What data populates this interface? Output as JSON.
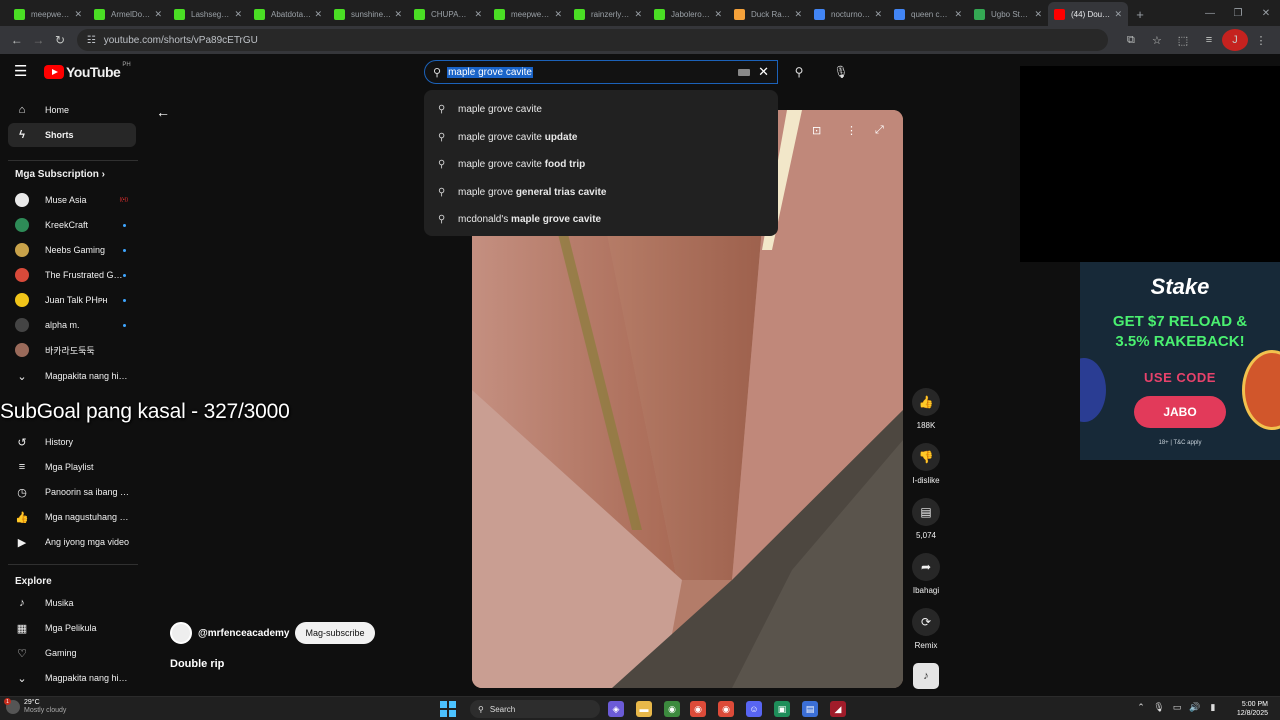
{
  "browser": {
    "tabs": [
      {
        "label": "meepwe…",
        "favicon_color": "#4ade24",
        "active": false
      },
      {
        "label": "ArmelDot…",
        "favicon_color": "#4ade24",
        "active": false
      },
      {
        "label": "Lashsegw…",
        "favicon_color": "#4ade24",
        "active": false
      },
      {
        "label": "Abatdota…",
        "favicon_color": "#4ade24",
        "active": false
      },
      {
        "label": "sunshinen…",
        "favicon_color": "#4ade24",
        "active": false
      },
      {
        "label": "CHUPAEN…",
        "favicon_color": "#4ade24",
        "active": false
      },
      {
        "label": "meepwe…",
        "favicon_color": "#4ade24",
        "active": false
      },
      {
        "label": "rainzerlyn…",
        "favicon_color": "#4ade24",
        "active": false
      },
      {
        "label": "JaboleroD…",
        "favicon_color": "#4ade24",
        "active": false
      },
      {
        "label": "Duck Race…",
        "favicon_color": "#f4a13a",
        "active": false
      },
      {
        "label": "nocturno…",
        "favicon_color": "#4285f4",
        "active": false
      },
      {
        "label": "queen coa…",
        "favicon_color": "#4285f4",
        "active": false
      },
      {
        "label": "Ugbo St…",
        "favicon_color": "#34a853",
        "active": false
      },
      {
        "label": "(44) Doub…",
        "favicon_color": "#ff0000",
        "active": true
      }
    ],
    "url": "youtube.com/shorts/vPa89cETrGU",
    "profile_initial": "J"
  },
  "masthead": {
    "logo_text": "YouTube",
    "country_code": "PH",
    "search_value": "maple grove cavite"
  },
  "suggestions": [
    {
      "base": "maple grove cavite",
      "bold": ""
    },
    {
      "base": "maple grove cavite ",
      "bold": "update"
    },
    {
      "base": "maple grove cavite ",
      "bold": "food trip"
    },
    {
      "base": "maple grove ",
      "bold": "general trias cavite"
    },
    {
      "base": "mcdonald's ",
      "bold": "maple grove cavite"
    }
  ],
  "sidebar": {
    "main": [
      {
        "label": "Home",
        "icon": "home-icon"
      },
      {
        "label": "Shorts",
        "icon": "shorts-icon",
        "active": true
      }
    ],
    "subscriptions_title": "Mga Subscription",
    "subscriptions": [
      {
        "label": "Muse Asia",
        "avatar_color": "#e9e9e9",
        "badge": "live"
      },
      {
        "label": "KreekCraft",
        "avatar_color": "#2e8b57",
        "badge": "dot"
      },
      {
        "label": "Neebs Gaming",
        "avatar_color": "#c8a24a",
        "badge": "dot"
      },
      {
        "label": "The Frustrated G…",
        "avatar_color": "#d84a3a",
        "badge": "dot"
      },
      {
        "label": "Juan Talk PHᴘʜ",
        "avatar_color": "#f0c419",
        "badge": "dot"
      },
      {
        "label": "alpha m.",
        "avatar_color": "#444444",
        "badge": "dot"
      },
      {
        "label": "바카라도둑둑",
        "avatar_color": "#9a6a5a",
        "badge": ""
      }
    ],
    "show_more": "Magpakita nang hi…",
    "you_items": [
      {
        "label": "History",
        "icon": "history-icon"
      },
      {
        "label": "Mga Playlist",
        "icon": "playlist-icon"
      },
      {
        "label": "Panoorin sa ibang …",
        "icon": "watch-later-icon"
      },
      {
        "label": "Mga nagustuhang …",
        "icon": "like-icon"
      },
      {
        "label": "Ang iyong mga video",
        "icon": "your-videos-icon"
      }
    ],
    "explore_title": "Explore",
    "explore": [
      {
        "label": "Musika",
        "icon": "music-icon"
      },
      {
        "label": "Mga Pelikula",
        "icon": "movies-icon"
      },
      {
        "label": "Gaming",
        "icon": "gaming-icon"
      },
      {
        "label": "Magpakita nang hi…",
        "icon": "chevron-down-icon"
      }
    ]
  },
  "overlay": {
    "text": "SubGoal pang kasal - 327/3000"
  },
  "short": {
    "channel": "@mrfenceacademy",
    "subscribe_label": "Mag-subscribe",
    "title": "Double rip"
  },
  "actions": [
    {
      "label": "188K",
      "icon": "thumb-up-icon"
    },
    {
      "label": "I-dislike",
      "icon": "thumb-down-icon"
    },
    {
      "label": "5,074",
      "icon": "comment-icon"
    },
    {
      "label": "Ibahagi",
      "icon": "share-icon"
    },
    {
      "label": "Remix",
      "icon": "remix-icon"
    }
  ],
  "ad": {
    "brand": "Stake",
    "headline_1": "GET $7 RELOAD &",
    "headline_2": "3.5% RAKEBACK!",
    "use_code": "USE CODE",
    "code": "JABO",
    "terms": "18+ | T&C apply"
  },
  "taskbar": {
    "weather_temp": "29°C",
    "weather_desc": "Mostly cloudy",
    "weather_badge": "1",
    "search_label": "Search",
    "time": "5:00 PM",
    "date": "12/8/2025"
  }
}
